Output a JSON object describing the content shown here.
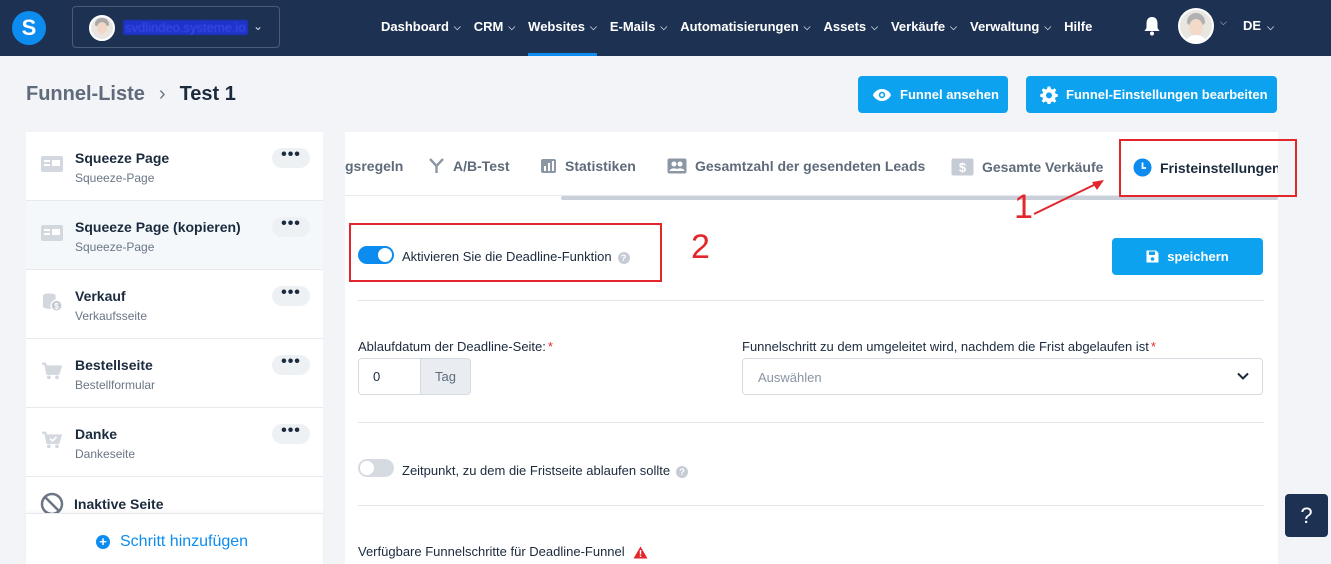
{
  "topbar": {
    "logo_letter": "S",
    "workspace_name": "svdlindeo.systeme.io",
    "nav": [
      {
        "label": "Dashboard",
        "has_menu": true
      },
      {
        "label": "CRM",
        "has_menu": true
      },
      {
        "label": "Websites",
        "has_menu": true,
        "active": true
      },
      {
        "label": "E-Mails",
        "has_menu": true
      },
      {
        "label": "Automatisierungen",
        "has_menu": true
      },
      {
        "label": "Assets",
        "has_menu": true
      },
      {
        "label": "Verkäufe",
        "has_menu": true
      },
      {
        "label": "Verwaltung",
        "has_menu": true
      },
      {
        "label": "Hilfe",
        "has_menu": false
      }
    ],
    "language": "DE"
  },
  "header": {
    "breadcrumb_root": "Funnel-Liste",
    "breadcrumb_current": "Test 1",
    "view_button": "Funnel ansehen",
    "settings_button": "Funnel-Einstellungen bearbeiten"
  },
  "sidebar": {
    "steps": [
      {
        "title": "Squeeze Page",
        "subtitle": "Squeeze-Page",
        "icon": "page-icon"
      },
      {
        "title": "Squeeze Page (kopieren)",
        "subtitle": "Squeeze-Page",
        "icon": "page-icon",
        "selected": true
      },
      {
        "title": "Verkauf",
        "subtitle": "Verkaufsseite",
        "icon": "coins-icon"
      },
      {
        "title": "Bestellseite",
        "subtitle": "Bestellformular",
        "icon": "cart-icon"
      },
      {
        "title": "Danke",
        "subtitle": "Dankeseite",
        "icon": "cart-check-icon"
      }
    ],
    "more_label": "•••",
    "inactive_label": "Inaktive Seite",
    "add_step_label": "Schritt hinzufügen"
  },
  "tabs": [
    {
      "label": "gsregeln",
      "icon": ""
    },
    {
      "label": "A/B-Test",
      "icon": "split-icon"
    },
    {
      "label": "Statistiken",
      "icon": "bar-chart-icon"
    },
    {
      "label": "Gesamtzahl der gesendeten Leads",
      "icon": "users-icon"
    },
    {
      "label": "Gesamte Verkäufe",
      "icon": "dollar-icon"
    },
    {
      "label": "Fristeinstellungen",
      "icon": "clock-icon",
      "active": true
    }
  ],
  "deadline": {
    "enable_label": "Aktivieren Sie die Deadline-Funktion",
    "enable_on": true,
    "save_button": "speichern",
    "expiry_label": "Ablaufdatum der Deadline-Seite:",
    "expiry_value": "0",
    "expiry_unit": "Tag",
    "redirect_label": "Funnelschritt zu dem umgeleitet wird, nachdem die Frist abgelaufen ist",
    "redirect_placeholder": "Auswählen",
    "required_mark": "*",
    "time_label": "Zeitpunkt, zu dem die Fristseite ablaufen sollte",
    "time_on": false,
    "available_label": "Verfügbare Funnelschritte für Deadline-Funnel"
  },
  "annotations": {
    "one": "1",
    "two": "2"
  },
  "help_fab": "?",
  "colors": {
    "nav_bg": "#1d3253",
    "accent": "#0da2f0",
    "annotation": "#e3262b"
  }
}
